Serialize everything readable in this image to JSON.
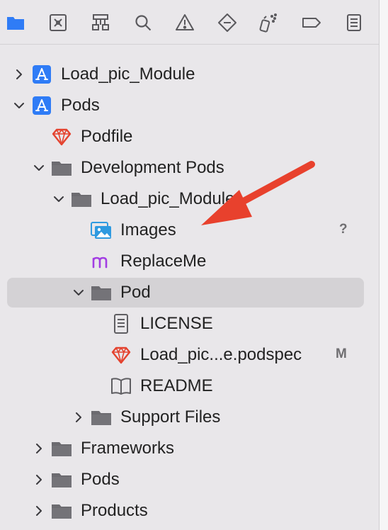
{
  "toolbar": {
    "icons": [
      "folder-icon",
      "source-control-icon",
      "hierarchy-icon",
      "search-icon",
      "warning-icon",
      "test-diamond-icon",
      "debug-spray-icon",
      "breakpoint-icon",
      "report-icon"
    ]
  },
  "tree": [
    {
      "label": "Load_pic_Module",
      "icon": "app-project-icon",
      "level": 0,
      "chevron": "right",
      "selected": false,
      "badge": ""
    },
    {
      "label": "Pods",
      "icon": "app-project-icon",
      "level": 0,
      "chevron": "down",
      "selected": false,
      "badge": ""
    },
    {
      "label": "Podfile",
      "icon": "ruby-gem-icon",
      "level": 1,
      "chevron": "",
      "selected": false,
      "badge": ""
    },
    {
      "label": "Development Pods",
      "icon": "folder-icon",
      "level": 1,
      "chevron": "down",
      "selected": false,
      "badge": ""
    },
    {
      "label": "Load_pic_Module",
      "icon": "folder-icon",
      "level": 2,
      "chevron": "down",
      "selected": false,
      "badge": ""
    },
    {
      "label": "Images",
      "icon": "image-assets-icon",
      "level": 3,
      "chevron": "",
      "selected": false,
      "badge": "?"
    },
    {
      "label": "ReplaceMe",
      "icon": "m-file-icon",
      "level": 3,
      "chevron": "",
      "selected": false,
      "badge": ""
    },
    {
      "label": "Pod",
      "icon": "folder-icon",
      "level": 3,
      "chevron": "down",
      "selected": true,
      "badge": ""
    },
    {
      "label": "LICENSE",
      "icon": "document-icon",
      "level": 4,
      "chevron": "",
      "selected": false,
      "badge": ""
    },
    {
      "label": "Load_pic...e.podspec",
      "icon": "ruby-gem-icon",
      "level": 4,
      "chevron": "",
      "selected": false,
      "badge": "M"
    },
    {
      "label": "README",
      "icon": "book-icon",
      "level": 4,
      "chevron": "",
      "selected": false,
      "badge": ""
    },
    {
      "label": "Support Files",
      "icon": "folder-icon",
      "level": 3,
      "chevron": "right",
      "selected": false,
      "badge": ""
    },
    {
      "label": "Frameworks",
      "icon": "folder-icon",
      "level": 1,
      "chevron": "right",
      "selected": false,
      "badge": ""
    },
    {
      "label": "Pods",
      "icon": "folder-icon",
      "level": 1,
      "chevron": "right",
      "selected": false,
      "badge": ""
    },
    {
      "label": "Products",
      "icon": "folder-icon",
      "level": 1,
      "chevron": "right",
      "selected": false,
      "badge": ""
    }
  ],
  "colors": {
    "accent": "#2f7cf6",
    "folder": "#6c6b70",
    "gem": "#e4432f",
    "m_file": "#a23de3",
    "arrow": "#e8412d"
  }
}
